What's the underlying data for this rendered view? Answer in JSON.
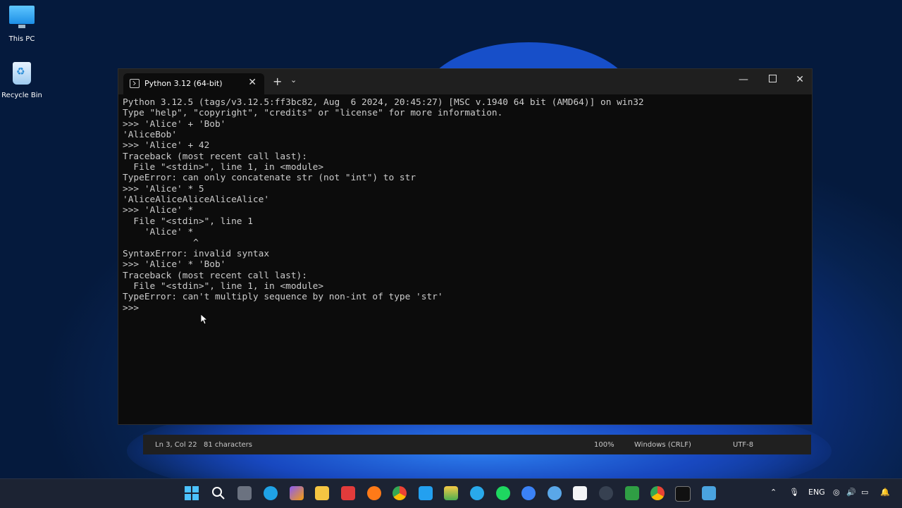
{
  "desktop": {
    "icons": [
      {
        "label": "This PC"
      },
      {
        "label": "Recycle Bin"
      }
    ]
  },
  "terminal": {
    "tab_title": "Python 3.12 (64-bit)",
    "lines": [
      "Python 3.12.5 (tags/v3.12.5:ff3bc82, Aug  6 2024, 20:45:27) [MSC v.1940 64 bit (AMD64)] on win32",
      "Type \"help\", \"copyright\", \"credits\" or \"license\" for more information.",
      ">>> 'Alice' + 'Bob'",
      "'AliceBob'",
      ">>> 'Alice' + 42",
      "Traceback (most recent call last):",
      "  File \"<stdin>\", line 1, in <module>",
      "TypeError: can only concatenate str (not \"int\") to str",
      ">>> 'Alice' * 5",
      "'AliceAliceAliceAliceAlice'",
      ">>> 'Alice' *",
      "  File \"<stdin>\", line 1",
      "    'Alice' *",
      "             ^",
      "SyntaxError: invalid syntax",
      ">>> 'Alice' * 'Bob'",
      "Traceback (most recent call last):",
      "  File \"<stdin>\", line 1, in <module>",
      "TypeError: can't multiply sequence by non-int of type 'str'",
      ">>> "
    ]
  },
  "notepad_status": {
    "position": "Ln 3, Col 22",
    "characters": "81 characters",
    "zoom": "100%",
    "line_ending": "Windows (CRLF)",
    "encoding": "UTF-8"
  },
  "tray": {
    "language": "ENG"
  },
  "colors": {
    "terminal_bg": "#0c0c0c",
    "terminal_fg": "#cccccc",
    "titlebar_bg": "#1f1f1f",
    "taskbar_bg": "#1c2333"
  }
}
